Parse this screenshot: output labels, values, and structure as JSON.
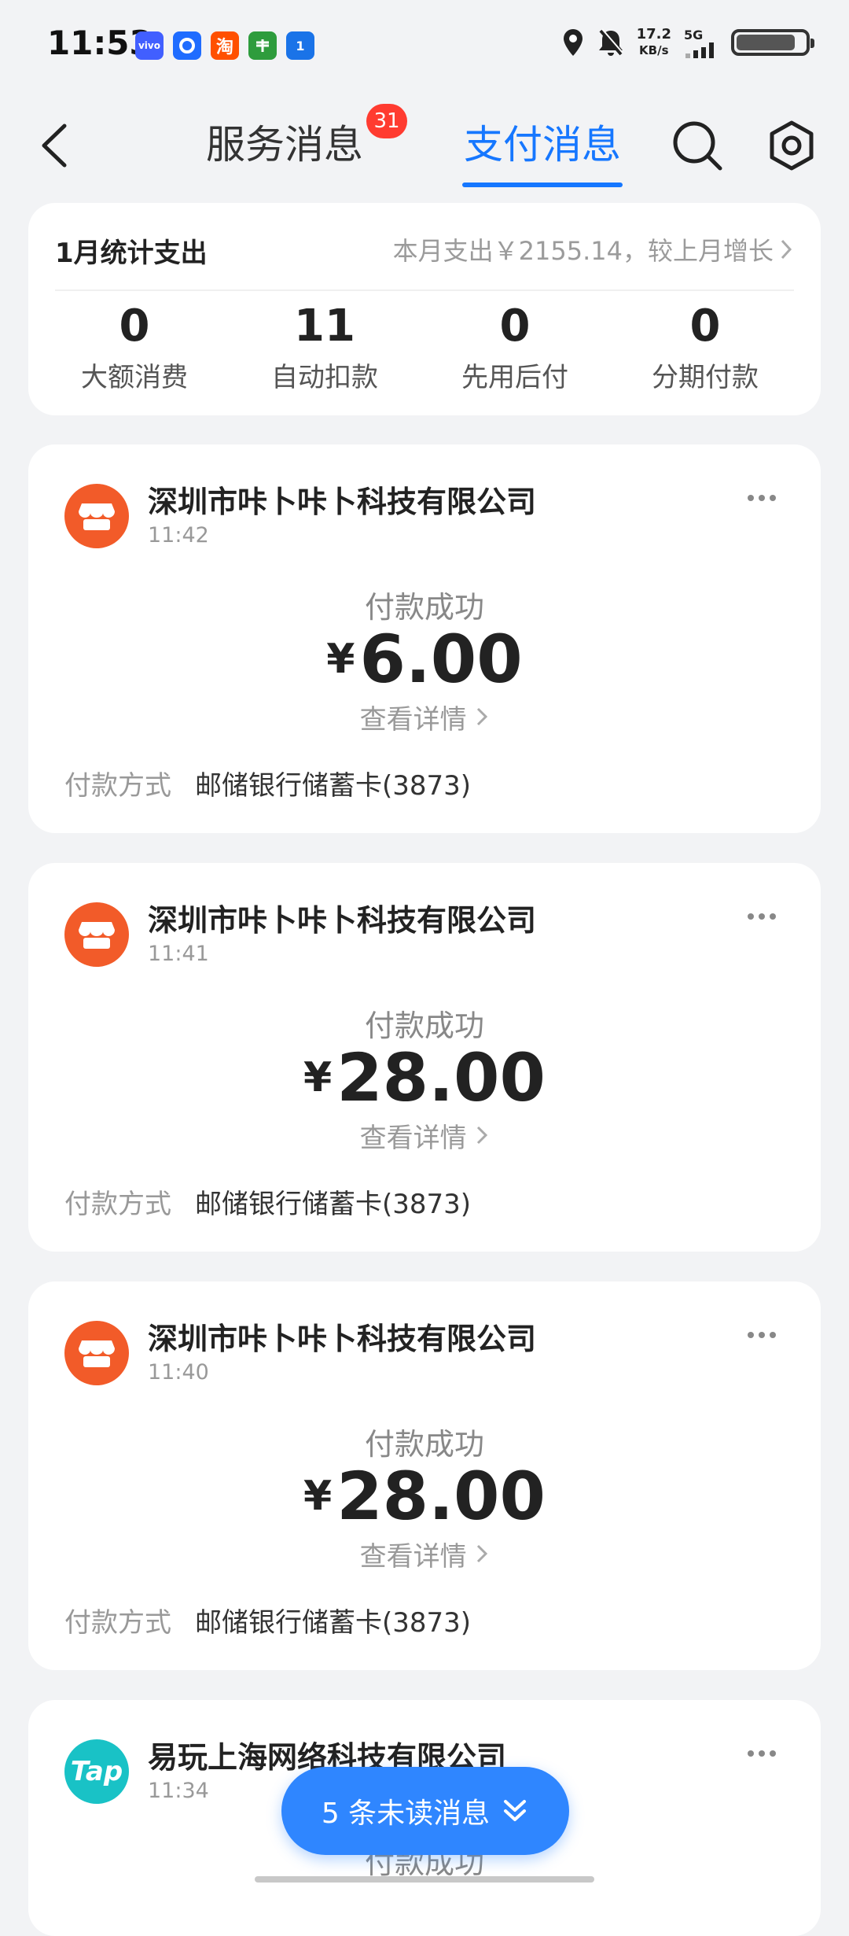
{
  "status_bar": {
    "time": "11:53",
    "apps": [
      {
        "name": "vivo",
        "color": "#415fff"
      },
      {
        "name": "",
        "color": "#1f6cff"
      },
      {
        "name": "淘",
        "color": "#ff5000"
      },
      {
        "name": "",
        "color": "#2e9c3d"
      },
      {
        "name": "1",
        "color": "#1a73e8"
      }
    ],
    "speed_value": "17.2",
    "speed_unit": "KB/s",
    "network": "5G"
  },
  "nav": {
    "tabs": [
      {
        "label": "服务消息",
        "badge": "31",
        "active": false
      },
      {
        "label": "支付消息",
        "active": true
      }
    ],
    "accent_color": "#1677ff"
  },
  "stats": {
    "title": "1月统计支出",
    "summary": "本月支出￥2155.14，较上月增长",
    "items": [
      {
        "value": "0",
        "label": "大额消费"
      },
      {
        "value": "11",
        "label": "自动扣款"
      },
      {
        "value": "0",
        "label": "先用后付"
      },
      {
        "value": "0",
        "label": "分期付款"
      }
    ]
  },
  "payments": [
    {
      "merchant": "深圳市咔卜咔卜科技有限公司",
      "time": "11:42",
      "status": "付款成功",
      "currency": "¥",
      "amount": "6.00",
      "detail": "查看详情",
      "method_label": "付款方式",
      "method": "邮储银行储蓄卡(3873)"
    },
    {
      "merchant": "深圳市咔卜咔卜科技有限公司",
      "time": "11:41",
      "status": "付款成功",
      "currency": "¥",
      "amount": "28.00",
      "detail": "查看详情",
      "method_label": "付款方式",
      "method": "邮储银行储蓄卡(3873)"
    },
    {
      "merchant": "深圳市咔卜咔卜科技有限公司",
      "time": "11:40",
      "status": "付款成功",
      "currency": "¥",
      "amount": "28.00",
      "detail": "查看详情",
      "method_label": "付款方式",
      "method": "邮储银行储蓄卡(3873)"
    },
    {
      "merchant": "易玩上海网络科技有限公司",
      "time": "11:34",
      "status": "付款成功",
      "icon_text": "Tap"
    }
  ],
  "unread": {
    "label": "5 条未读消息"
  }
}
